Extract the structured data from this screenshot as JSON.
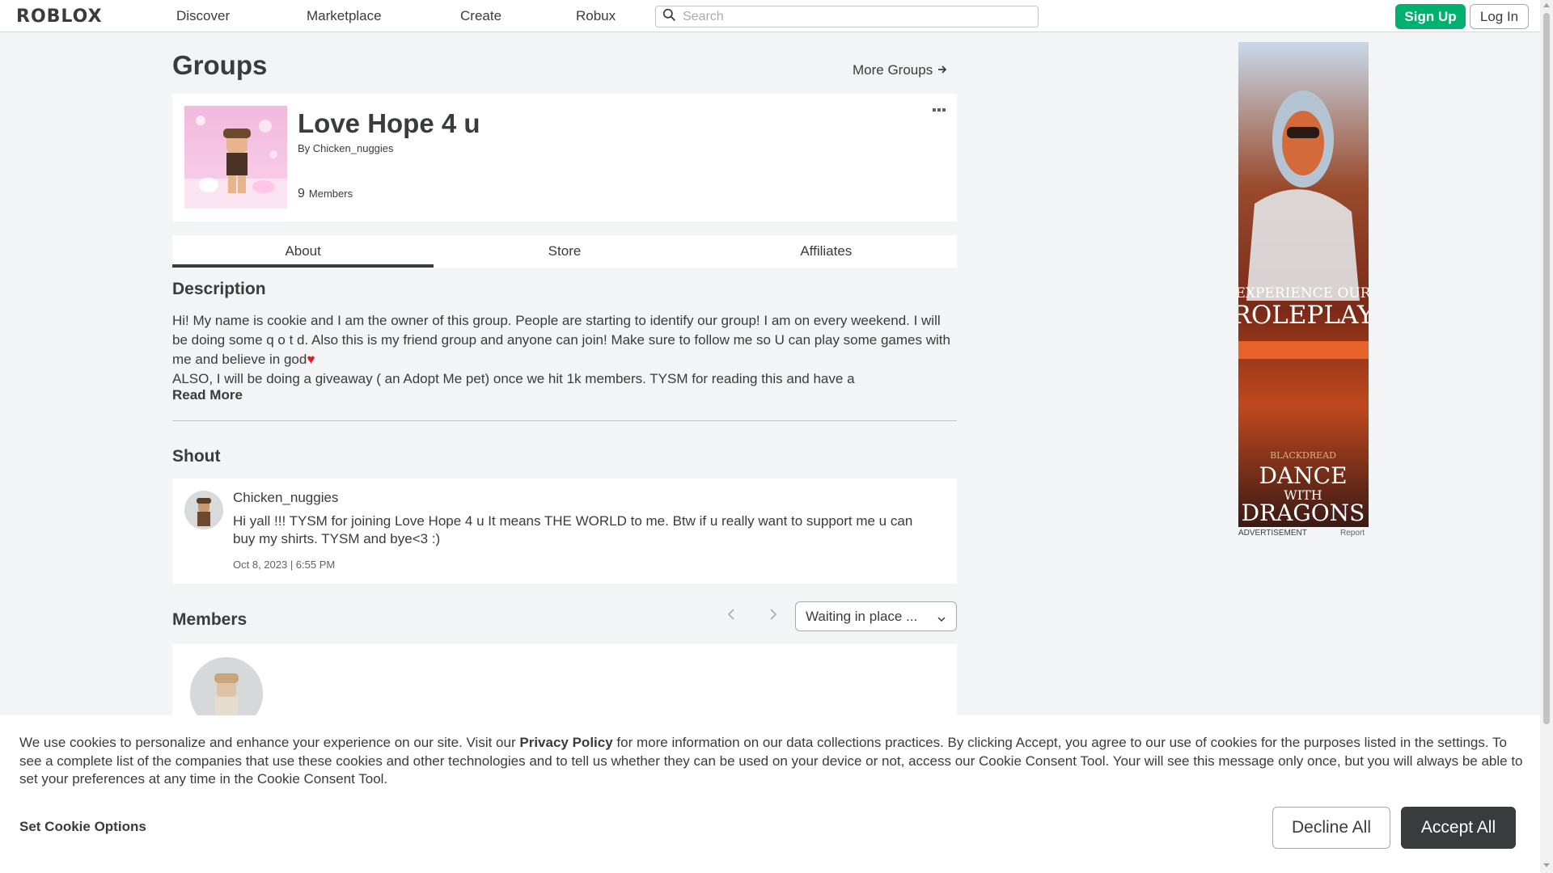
{
  "nav": {
    "logo": "RΟBLOX",
    "links": [
      "Discover",
      "Marketplace",
      "Create",
      "Robux"
    ],
    "search_placeholder": "Search",
    "signup_label": "Sign Up",
    "login_label": "Log In"
  },
  "page": {
    "title": "Groups",
    "more_groups": "More Groups"
  },
  "group": {
    "name": "Love Hope 4 u",
    "by_prefix": "By",
    "owner": "Chicken_nuggies",
    "member_count": "9",
    "members_label": "Members"
  },
  "tabs": [
    "About",
    "Store",
    "Affiliates"
  ],
  "description": {
    "heading": "Description",
    "text_part1": "Hi! My name is cookie and I am the owner of this group. People are starting to identify our group! I am on every weekend. I will be doing some q o t d. Also this is my friend group and anyone can join! Make sure to follow me so U can play some games with me and believe in god",
    "heart": "♥",
    "text_part2": "ALSO, I will be doing a giveaway ( an Adopt Me pet) once we hit 1k members. TYSM for reading this and have a",
    "read_more": "Read More"
  },
  "shout": {
    "heading": "Shout",
    "author": "Chicken_nuggies",
    "body": "Hi yall !!! TYSM for joining Love Hope 4 u It means THE WORLD to me. Btw if u really want to support me u can buy my shirts. TYSM and bye<3 :)",
    "date": "Oct 8, 2023 | 6:55 PM"
  },
  "members": {
    "heading": "Members",
    "filter_value": "Waiting in place ..."
  },
  "ad": {
    "label": "ADVERTISEMENT",
    "report": "Report",
    "line1": "EXPERIENCE OUR",
    "line2": "ROLEPLAY",
    "line3": "BLACKDREAD",
    "line4": "DANCE",
    "line5": "WITH",
    "line6": "DRAGONS"
  },
  "cookie": {
    "text_before": "We use cookies to personalize and enhance your experience on our site. Visit our",
    "privacy_policy": "Privacy Policy",
    "text_after": "for more information on our data collections practices. By clicking Accept, you agree to our use of cookies for the purposes listed in the settings. To see a complete list of the companies that use these cookies and other technologies and to tell us whether they can be used on your device or not, access our Cookie Consent Tool. Your will see this message only once, but you will always be able to set your preferences at any time in the Cookie Consent Tool.",
    "set_options": "Set Cookie Options",
    "decline": "Decline All",
    "accept": "Accept All"
  },
  "colors": {
    "accent_green": "#00b06f",
    "text_dark": "#393b3d",
    "background": "#f2f4f5"
  }
}
